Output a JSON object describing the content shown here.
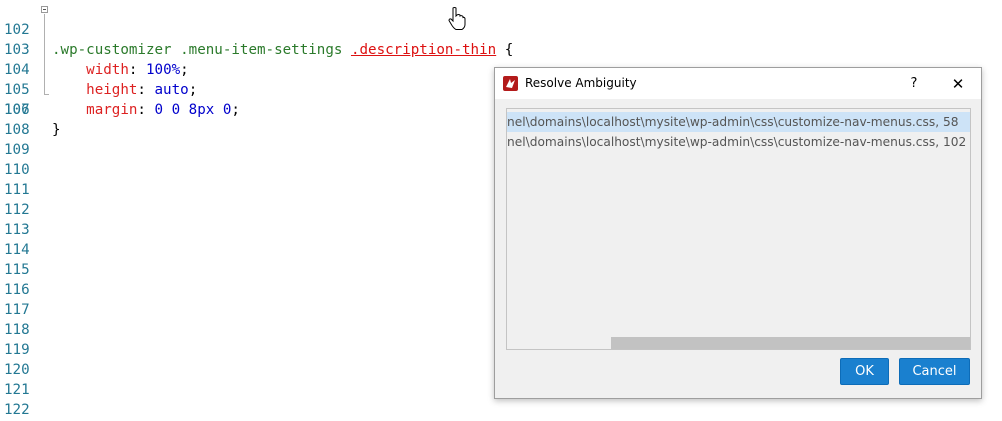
{
  "editor": {
    "lines": [
      {
        "num": "102"
      },
      {
        "num": "103"
      },
      {
        "num": "104"
      },
      {
        "num": "105"
      },
      {
        "num": "106"
      },
      {
        "num": "107"
      },
      {
        "num": "108"
      },
      {
        "num": "109"
      },
      {
        "num": "110"
      },
      {
        "num": "111"
      },
      {
        "num": "112"
      },
      {
        "num": "113"
      },
      {
        "num": "114"
      },
      {
        "num": "115"
      },
      {
        "num": "116"
      },
      {
        "num": "117"
      },
      {
        "num": "118"
      },
      {
        "num": "119"
      },
      {
        "num": "120"
      },
      {
        "num": "121"
      },
      {
        "num": "122"
      }
    ],
    "selector_main": ".wp-customizer .menu-item-settings ",
    "selector_link": ".description-thin",
    "open_brace": " {",
    "close_brace": "}",
    "width_prop": "width",
    "width_val": "100%",
    "height_prop": "height",
    "height_val": "auto",
    "margin_prop": "margin",
    "margin_val": "0 0 8px 0",
    "colon": ": ",
    "semi": ";"
  },
  "dialog": {
    "title": "Resolve Ambiguity",
    "help_label": "?",
    "close_label": "✕",
    "items": [
      {
        "text": "nel\\domains\\localhost\\mysite\\wp-admin\\css\\customize-nav-menus.css, 58"
      },
      {
        "text": "nel\\domains\\localhost\\mysite\\wp-admin\\css\\customize-nav-menus.css, 102"
      }
    ],
    "ok_label": "OK",
    "cancel_label": "Cancel"
  },
  "colors": {
    "accent": "#1a80cf",
    "selection": "#cde3f7",
    "line_number": "#237893",
    "selector": "#2b7a2b",
    "property": "#d22222",
    "value": "#0000cc"
  }
}
